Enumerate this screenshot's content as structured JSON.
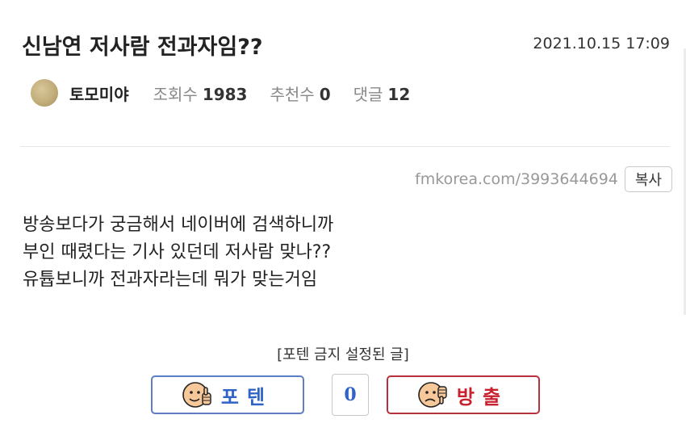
{
  "post": {
    "title": "신남연 저사람 전과자임??",
    "date": "2021.10.15 17:09",
    "author": "토모미야",
    "views_label": "조회수",
    "views": "1983",
    "recommend_label": "추천수",
    "recommend": "0",
    "comments_label": "댓글",
    "comments": "12"
  },
  "url_row": {
    "url": "fmkorea.com/3993644694",
    "copy_label": "복사"
  },
  "body": {
    "lines": [
      "방송보다가 궁금해서 네이버에 검색하니까",
      "부인 때렸다는 기사 있던데 저사람 맞나??",
      "유튭보니까 전과자라는데 뭐가 맞는거임"
    ]
  },
  "vote": {
    "notice": "[포텐 금지 설정된 글]",
    "up_label": "포텐",
    "down_label": "방출",
    "count": "0",
    "up_color": "#2f63c7",
    "down_color": "#c8202f",
    "up_icon": "thumbs-up-face-icon",
    "down_icon": "thumbs-down-face-icon"
  }
}
